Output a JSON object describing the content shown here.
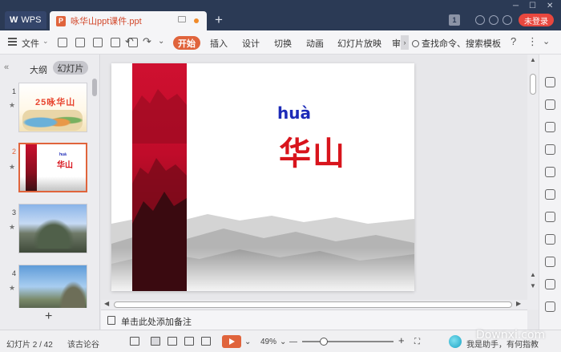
{
  "titlebar": {
    "wps_label": "WPS",
    "doc_tab_title": "咏华山ppt课件.ppt",
    "new_tab_symbol": "+",
    "badge_number": "1",
    "login_label": "未登录",
    "win_minimize": "─",
    "win_maximize": "☐",
    "win_close": "✕",
    "colors": {
      "bar": "#2b3a55",
      "accent": "#e0643c",
      "login": "#e8473e"
    }
  },
  "menubar": {
    "file_label": "文件",
    "file_chevron": "⌄",
    "undo": "↶",
    "redo": "↷",
    "more": "⌄",
    "tabs": [
      "开始",
      "插入",
      "设计",
      "切换",
      "动画",
      "幻灯片放映",
      "审"
    ],
    "more_tabs": "›",
    "search_label": "查找命令、搜索模板",
    "help_icon": "?",
    "more_icon": "⋮",
    "collapse_icon": "⌄"
  },
  "leftpanel": {
    "collapse_icon": "«",
    "outline_label": "大纲",
    "slides_label": "幻灯片",
    "add_slide": "+",
    "thumbnails": [
      {
        "number": "1",
        "star": "★",
        "title": "25咏华山"
      },
      {
        "number": "2",
        "star": "★",
        "pinyin": "huà",
        "title": "华山"
      },
      {
        "number": "3",
        "star": "★"
      },
      {
        "number": "4",
        "star": "★"
      }
    ]
  },
  "slide": {
    "pinyin": "huà",
    "title": "华山"
  },
  "scroll": {
    "up": "▲",
    "down": "▼",
    "left": "◀",
    "right": "▶"
  },
  "notes": {
    "placeholder": "单击此处添加备注"
  },
  "statusbar": {
    "slide_counter": "幻灯片 2 / 42",
    "theme_name": "该古论谷",
    "zoom_level": "49%",
    "zoom_chevron": "⌄",
    "zoom_minus": "—",
    "zoom_plus": "+",
    "fit_icon": "⛶",
    "assistant_label": "我是助手，有何指教"
  },
  "watermark": "Downxi.com"
}
